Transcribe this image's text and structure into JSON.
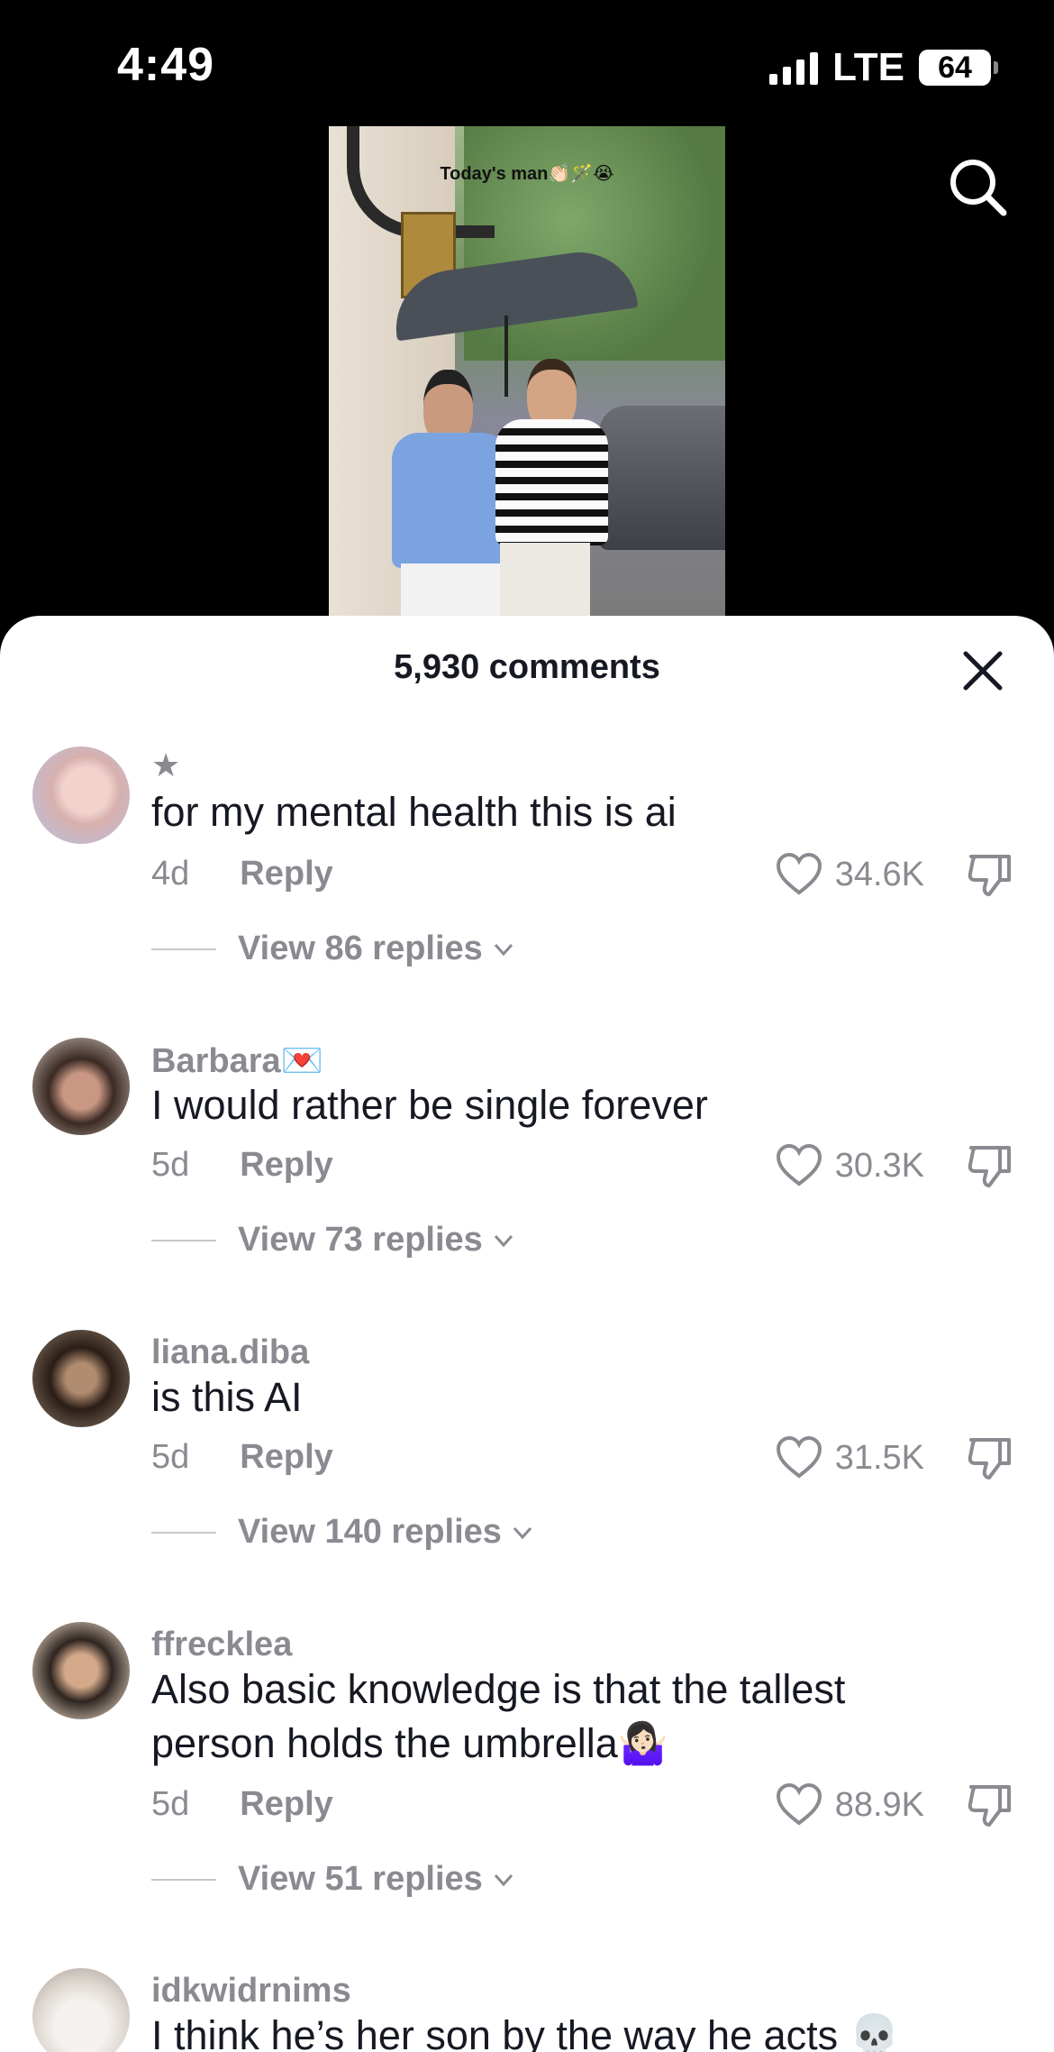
{
  "status_bar": {
    "time": "4:49",
    "network": "LTE",
    "battery": "64"
  },
  "video": {
    "caption": "Today's man👏🏻🪄😭"
  },
  "sheet": {
    "title": "5,930 comments",
    "comments": [
      {
        "username": "★",
        "text": "for my mental health this is ai",
        "age": "4d",
        "reply_label": "Reply",
        "likes": "34.6K",
        "view_replies": "View 86 replies"
      },
      {
        "username": "Barbara💌",
        "text": "I would rather be single forever",
        "age": "5d",
        "reply_label": "Reply",
        "likes": "30.3K",
        "view_replies": "View 73 replies"
      },
      {
        "username": "liana.diba",
        "text": "is this AI",
        "age": "5d",
        "reply_label": "Reply",
        "likes": "31.5K",
        "view_replies": "View 140 replies"
      },
      {
        "username": "ffrecklea",
        "text": "Also basic knowledge is that the tallest person holds the umbrella🤷🏻‍♀️",
        "age": "5d",
        "reply_label": "Reply",
        "likes": "88.9K",
        "view_replies": "View 51 replies"
      },
      {
        "username": "idkwidrnims",
        "text": "I think he’s her son by the way he acts 💀"
      }
    ]
  },
  "icons": {
    "search": "search-icon",
    "close": "close-icon",
    "like": "heart-icon",
    "dislike": "dislike-icon",
    "expand": "chevron-down-icon"
  }
}
